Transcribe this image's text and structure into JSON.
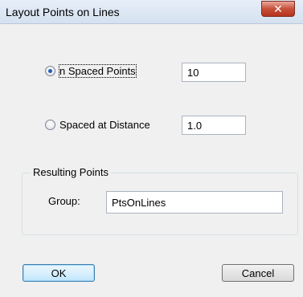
{
  "window": {
    "title": "Layout Points on Lines",
    "close_symbol": "✕"
  },
  "mode": {
    "option_n_points": {
      "label": "n Spaced Points",
      "selected": true,
      "value": "10"
    },
    "option_distance": {
      "label": "Spaced at Distance",
      "selected": false,
      "value": "1.0"
    }
  },
  "result": {
    "legend": "Resulting Points",
    "group_label": "Group:",
    "group_value": "PtsOnLines"
  },
  "buttons": {
    "ok": "OK",
    "cancel": "Cancel"
  },
  "colors": {
    "radio_dot": "#1f5fbf",
    "close_button": "#c7503a"
  }
}
